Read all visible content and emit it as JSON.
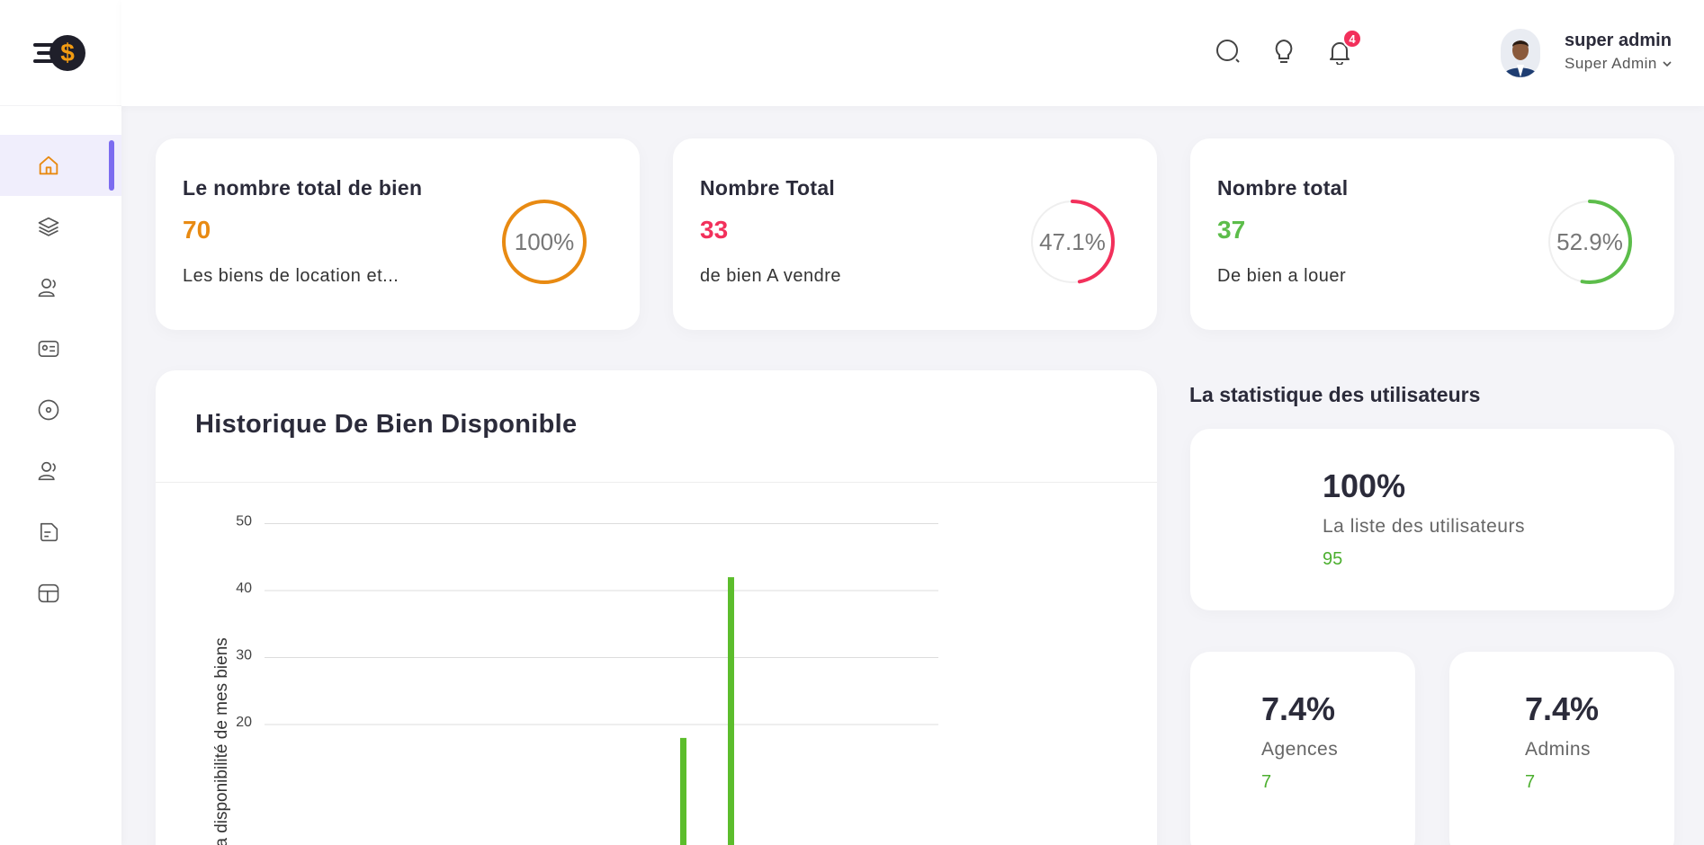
{
  "header": {
    "notifications_count": "4",
    "user_name": "super admin",
    "user_role": "Super Admin"
  },
  "stats": [
    {
      "title": "Le nombre total de bien",
      "value": "70",
      "description": "Les biens de location et...",
      "percent_label": "100%",
      "percent": 100,
      "color": "#e88a12"
    },
    {
      "title": "Nombre Total",
      "value": "33",
      "description": "de bien A vendre",
      "percent_label": "47.1%",
      "percent": 47.1,
      "color": "#f2305b"
    },
    {
      "title": "Nombre total",
      "value": "37",
      "description": "De bien a louer",
      "percent_label": "52.9%",
      "percent": 52.9,
      "color": "#5cbd4a"
    }
  ],
  "history": {
    "title": "Historique De Bien Disponible"
  },
  "chart_data": {
    "type": "bar",
    "ylabel": "et la disponibilité de mes biens",
    "ylim": [
      0,
      50
    ],
    "yticks": [
      20,
      30,
      40,
      50
    ],
    "series": [
      {
        "values": [
          18,
          42
        ]
      }
    ],
    "color": "#5cbd2c"
  },
  "user_stats": {
    "section_title": "La statistique des utilisateurs",
    "total": {
      "percent": "100%",
      "label": "La liste des utilisateurs",
      "count": "95"
    },
    "agences": {
      "percent": "7.4%",
      "label": "Agences",
      "count": "7"
    },
    "admins": {
      "percent": "7.4%",
      "label": "Admins",
      "count": "7"
    }
  }
}
